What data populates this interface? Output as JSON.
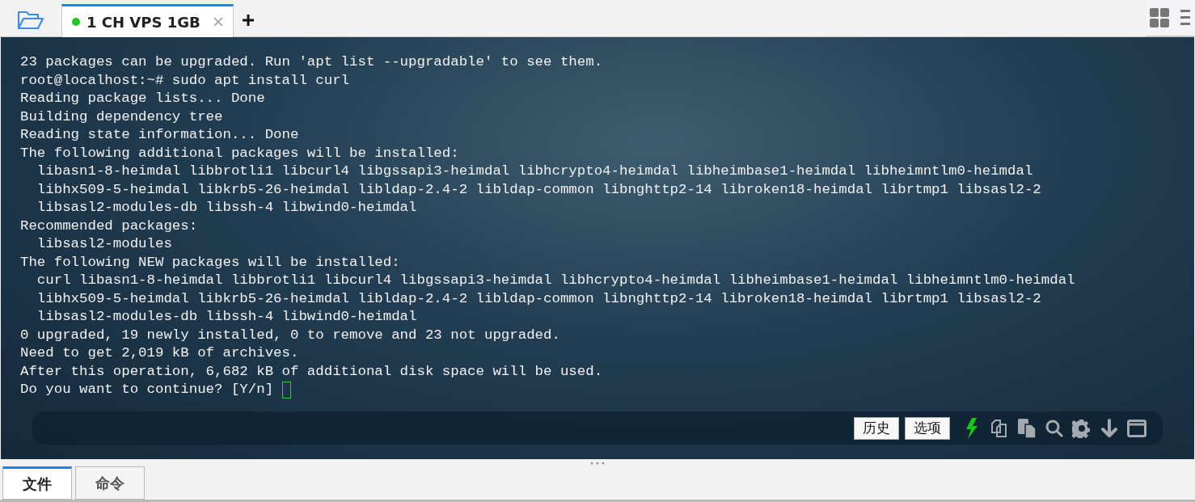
{
  "tabs": [
    {
      "label": "1 CH VPS 1GB",
      "selected": true,
      "connected": true
    }
  ],
  "terminal": {
    "lines": [
      "23 packages can be upgraded. Run 'apt list --upgradable' to see them.",
      "root@localhost:~# sudo apt install curl",
      "Reading package lists... Done",
      "Building dependency tree",
      "Reading state information... Done",
      "The following additional packages will be installed:",
      "  libasn1-8-heimdal libbrotli1 libcurl4 libgssapi3-heimdal libhcrypto4-heimdal libheimbase1-heimdal libheimntlm0-heimdal",
      "  libhx509-5-heimdal libkrb5-26-heimdal libldap-2.4-2 libldap-common libnghttp2-14 libroken18-heimdal librtmp1 libsasl2-2",
      "  libsasl2-modules-db libssh-4 libwind0-heimdal",
      "Recommended packages:",
      "  libsasl2-modules",
      "The following NEW packages will be installed:",
      "  curl libasn1-8-heimdal libbrotli1 libcurl4 libgssapi3-heimdal libhcrypto4-heimdal libheimbase1-heimdal libheimntlm0-heimdal",
      "  libhx509-5-heimdal libkrb5-26-heimdal libldap-2.4-2 libldap-common libnghttp2-14 libroken18-heimdal librtmp1 libsasl2-2",
      "  libsasl2-modules-db libssh-4 libwind0-heimdal",
      "0 upgraded, 19 newly installed, 0 to remove and 23 not upgraded.",
      "Need to get 2,019 kB of archives.",
      "After this operation, 6,682 kB of additional disk space will be used.",
      "Do you want to continue? [Y/n] "
    ],
    "toolbar_buttons": [
      "历史",
      "选项"
    ]
  },
  "bottom_tabs": [
    {
      "label": "文件",
      "selected": true
    },
    {
      "label": "命令",
      "selected": false
    }
  ]
}
